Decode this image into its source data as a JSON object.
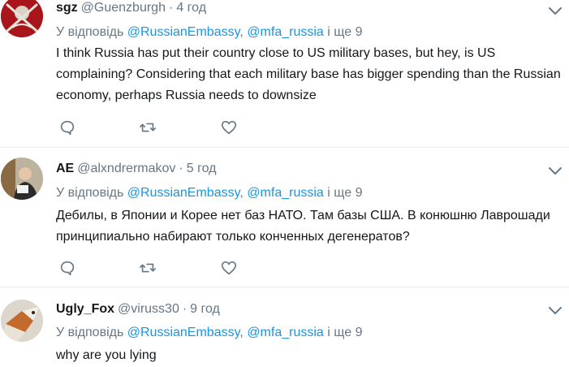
{
  "tweets": [
    {
      "name": "sgz",
      "handle": "@Guenzburgh",
      "dot": "·",
      "time": "4 год",
      "reply_prefix": "У відповідь",
      "mention1": "@RussianEmbassy",
      "comma": ",",
      "mention2": "@mfa_russia",
      "more": "і ще 9",
      "text": "I think Russia has put their country close to US military bases, but hey, is US complaining?  Considering that each military base has bigger spending than the Russian economy, perhaps Russia needs to downsize"
    },
    {
      "name": "AE",
      "handle": "@alxndrermakov",
      "dot": "·",
      "time": "5 год",
      "reply_prefix": "У відповідь",
      "mention1": "@RussianEmbassy",
      "comma": ",",
      "mention2": "@mfa_russia",
      "more": "і ще 9",
      "text": "Дебилы, в Японии и Корее нет баз НАТО. Там базы США. В конюшню Лаврошади принципиально набирают только конченных дегенератов?"
    },
    {
      "name": "Ugly_Fox",
      "handle": "@viruss30",
      "dot": "·",
      "time": "9 год",
      "reply_prefix": "У відповідь",
      "mention1": "@RussianEmbassy",
      "comma": ",",
      "mention2": "@mfa_russia",
      "more": "і ще 9",
      "text": "why are you lying"
    }
  ],
  "colors": {
    "link": "#1b95e0",
    "secondary": "#657786",
    "divider": "#e6ecf0",
    "text": "#14171a"
  },
  "icons": [
    "reply-icon",
    "retweet-icon",
    "like-icon",
    "chevron-down-icon"
  ]
}
